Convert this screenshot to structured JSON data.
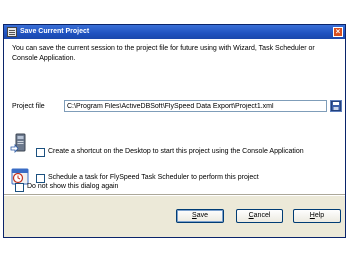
{
  "window": {
    "title": "Save Current Project"
  },
  "intro_text": "You can save the current session to the project file for future using with Wizard, Task Scheduler or Console Application.",
  "project_file": {
    "label": "Project file",
    "value": "C:\\Program Files\\ActiveDBSoft\\FlySpeed Data Export\\Project1.xml"
  },
  "options": {
    "shortcut_label": "Create a shortcut on the Desktop to start this project using the Console Application",
    "schedule_label": "Schedule a task for FlySpeed Task Scheduler to perform this project",
    "dont_show_label": "Do not show this dialog again"
  },
  "buttons": {
    "save": {
      "first": "S",
      "rest": "ave"
    },
    "cancel": {
      "first": "C",
      "rest": "ancel"
    },
    "help": {
      "first": "H",
      "rest": "elp"
    }
  }
}
